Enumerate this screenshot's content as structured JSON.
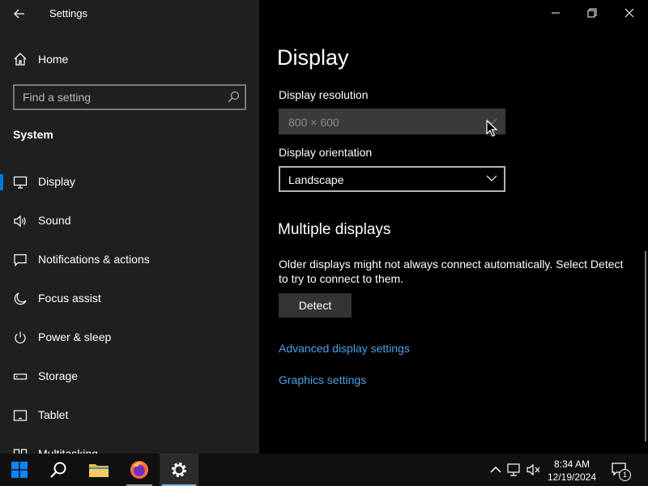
{
  "window": {
    "title": "Settings"
  },
  "sidebar": {
    "home_label": "Home",
    "search_placeholder": "Find a setting",
    "section_title": "System",
    "items": [
      {
        "label": "Display",
        "icon": "monitor-icon",
        "selected": true
      },
      {
        "label": "Sound",
        "icon": "speaker-icon"
      },
      {
        "label": "Notifications & actions",
        "icon": "notification-icon"
      },
      {
        "label": "Focus assist",
        "icon": "moon-icon"
      },
      {
        "label": "Power & sleep",
        "icon": "power-icon"
      },
      {
        "label": "Storage",
        "icon": "storage-icon"
      },
      {
        "label": "Tablet",
        "icon": "tablet-icon"
      },
      {
        "label": "Multitasking",
        "icon": "multitasking-icon"
      }
    ]
  },
  "main": {
    "title": "Display",
    "resolution": {
      "label": "Display resolution",
      "value": "800 × 600",
      "disabled": true
    },
    "orientation": {
      "label": "Display orientation",
      "value": "Landscape"
    },
    "multiple_displays": {
      "title": "Multiple displays",
      "description": "Older displays might not always connect automatically. Select Detect to try to connect to them.",
      "detect_label": "Detect"
    },
    "links": {
      "advanced": "Advanced display settings",
      "graphics": "Graphics settings"
    }
  },
  "taskbar": {
    "apps": [
      "start-icon",
      "search-icon",
      "file-explorer-icon",
      "firefox-icon",
      "settings-gear-icon"
    ],
    "time": "8:34 AM",
    "date": "12/19/2024",
    "notification_count": "1"
  },
  "colors": {
    "accent": "#0078d7",
    "link": "#4aa0e6",
    "sidebar_bg": "#1f1f1f",
    "main_bg": "#000000",
    "taskbar_bg": "#101010"
  }
}
